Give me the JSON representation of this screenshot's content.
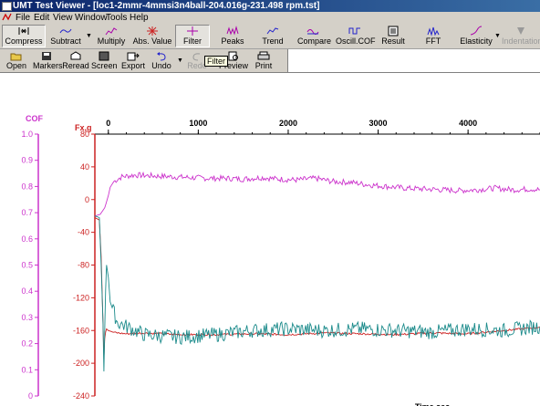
{
  "window": {
    "title": "UMT Test Viewer - [loc1-2mmr-4mmsi3n4ball-204.016g-231.498 rpm.tst]"
  },
  "menu": [
    "File",
    "Edit",
    "View",
    "Window",
    "Tools",
    "Help"
  ],
  "toolbar1": [
    {
      "label": "Compress",
      "icon": "compress-icon",
      "pressed": true
    },
    {
      "label": "Subtract",
      "icon": "subtract-icon"
    },
    {
      "label": "Multiply",
      "icon": "multiply-icon"
    },
    {
      "label": "Abs. Value",
      "icon": "abs-value-icon"
    },
    {
      "label": "Filter",
      "icon": "filter-icon",
      "pressed": true
    },
    {
      "label": "Peaks",
      "icon": "peaks-icon"
    },
    {
      "label": "Trend",
      "icon": "trend-icon"
    },
    {
      "label": "Compare",
      "icon": "compare-icon"
    },
    {
      "label": "Oscill.COF",
      "icon": "oscill-cof-icon"
    },
    {
      "label": "Result",
      "icon": "result-icon"
    },
    {
      "label": "FFT",
      "icon": "fft-icon"
    },
    {
      "label": "Elasticity",
      "icon": "elasticity-icon"
    },
    {
      "label": "Indentation",
      "icon": "indentation-icon",
      "disabled": true
    }
  ],
  "toolbar2": [
    {
      "label": "Open",
      "icon": "open-folder-icon"
    },
    {
      "label": "Markers",
      "icon": "markers-icon"
    },
    {
      "label": "Reread",
      "icon": "reread-icon"
    },
    {
      "label": "Screen",
      "icon": "screen-icon"
    },
    {
      "label": "Export",
      "icon": "export-icon"
    },
    {
      "label": "Undo",
      "icon": "undo-icon"
    },
    {
      "label": "Redo",
      "icon": "redo-icon",
      "disabled": true
    },
    {
      "label": "Preview",
      "icon": "preview-icon"
    },
    {
      "label": "Print",
      "icon": "print-icon"
    }
  ],
  "tooltip": "Filter",
  "colors": {
    "cof": "#cc33cc",
    "fx": "#cc2222",
    "noisy": "#1a8a8a",
    "titlebar": "#0a246a"
  },
  "chart_data": {
    "type": "line",
    "x_axis": {
      "range": [
        -150,
        4800
      ],
      "ticks": [
        0,
        1000,
        2000,
        3000,
        4000
      ],
      "label": "Time,sec"
    },
    "cof_axis": {
      "label": "COF",
      "range": [
        0,
        1.0
      ],
      "ticks": [
        "1.0",
        "0.9",
        "0.8",
        "0.7",
        "0.6",
        "0.5",
        "0.4",
        "0.3",
        "0.2",
        "0.1",
        "0"
      ]
    },
    "fx_axis": {
      "label": "Fx,g",
      "range": [
        -240,
        80
      ],
      "ticks": [
        "80",
        "40",
        "0",
        "-40",
        "-80",
        "-120",
        "-160",
        "-200",
        "-240"
      ]
    },
    "series": [
      {
        "axis": "fx",
        "color": "#cc33cc",
        "x": [
          -150,
          -90,
          -40,
          0,
          20,
          60,
          150,
          300,
          500,
          700,
          900,
          1100,
          1300,
          1500,
          1700,
          1900,
          2100,
          2300,
          2500,
          2700,
          2900,
          3100,
          3300,
          3500,
          3700,
          3900,
          4100,
          4300,
          4500,
          4700,
          4800
        ],
        "y": [
          -20,
          -18,
          -10,
          5,
          15,
          22,
          28,
          30,
          29,
          28,
          27,
          26,
          26,
          25,
          27,
          25,
          24,
          26,
          22,
          21,
          18,
          16,
          14,
          13,
          12,
          11,
          12,
          14,
          12,
          13,
          12
        ]
      },
      {
        "axis": "fx",
        "color": "#cc2222",
        "x": [
          -150,
          -100,
          -80,
          -60,
          -50,
          -40,
          -30,
          -20,
          0,
          50,
          100,
          200,
          400,
          800,
          1200,
          1600,
          2000,
          2400,
          2800,
          3200,
          3600,
          4000,
          4400,
          4800
        ],
        "y": [
          -22,
          -25,
          -70,
          -150,
          -195,
          -170,
          -162,
          -158,
          -160,
          -162,
          -163,
          -164,
          -163,
          -165,
          -165,
          -164,
          -165,
          -163,
          -164,
          -165,
          -163,
          -164,
          -160,
          -156
        ]
      },
      {
        "axis": "fx",
        "color": "#1a8a8a",
        "x": [
          -150,
          -100,
          -80,
          -60,
          -50,
          -40,
          -30,
          -20,
          0,
          20,
          100,
          400,
          800,
          1200,
          1600,
          2000,
          2400,
          2800,
          3200,
          3600,
          4000,
          4400,
          4800
        ],
        "y": [
          -20,
          -22,
          -80,
          -150,
          -210,
          -160,
          -110,
          -80,
          -95,
          -125,
          -150,
          -165,
          -168,
          -165,
          -160,
          -158,
          -160,
          -158,
          -160,
          -162,
          -158,
          -160,
          -155
        ]
      }
    ]
  }
}
